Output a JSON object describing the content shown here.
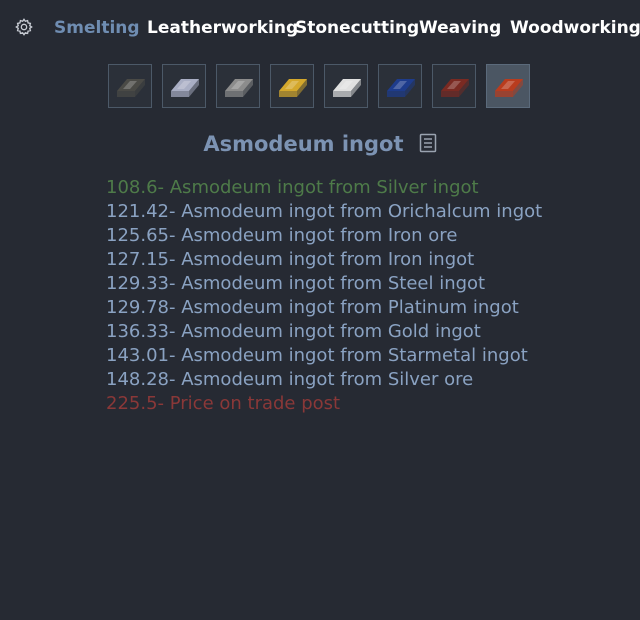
{
  "nav": {
    "settings_icon": "gear-icon",
    "tabs": [
      {
        "label": "Smelting",
        "active": true
      },
      {
        "label": "Leatherworking",
        "active": false
      },
      {
        "label": "Stonecutting",
        "active": false
      },
      {
        "label": "Weaving",
        "active": false
      },
      {
        "label": "Woodworking",
        "active": false
      }
    ]
  },
  "materials": [
    {
      "icon": "iron-ingot-icon",
      "color": "#4a4a46",
      "selected": false
    },
    {
      "icon": "steel-ingot-icon",
      "color": "#a9aec4",
      "selected": false
    },
    {
      "icon": "starmetal-ingot-icon",
      "color": "#8c8c8c",
      "selected": false
    },
    {
      "icon": "gold-ingot-icon",
      "color": "#d4a82c",
      "selected": false
    },
    {
      "icon": "silver-ingot-icon",
      "color": "#e0e0e0",
      "selected": false
    },
    {
      "icon": "orichalcum-ingot-icon",
      "color": "#1e3c8c",
      "selected": false
    },
    {
      "icon": "platinum-ingot-icon",
      "color": "#7a2a22",
      "selected": false
    },
    {
      "icon": "asmodeum-ingot-icon",
      "color": "#b93c1e",
      "selected": true
    }
  ],
  "item": {
    "title": "Asmodeum ingot",
    "details_icon": "document-icon"
  },
  "recipes": [
    {
      "text": "108.6- Asmodeum ingot from Silver ingot",
      "kind": "best"
    },
    {
      "text": "121.42- Asmodeum ingot from Orichalcum ingot",
      "kind": "normal"
    },
    {
      "text": "125.65- Asmodeum ingot from Iron ore",
      "kind": "normal"
    },
    {
      "text": "127.15- Asmodeum ingot from Iron ingot",
      "kind": "normal"
    },
    {
      "text": "129.33- Asmodeum ingot from Steel ingot",
      "kind": "normal"
    },
    {
      "text": "129.78- Asmodeum ingot from Platinum ingot",
      "kind": "normal"
    },
    {
      "text": "136.33- Asmodeum ingot from Gold ingot",
      "kind": "normal"
    },
    {
      "text": "143.01- Asmodeum ingot from Starmetal ingot",
      "kind": "normal"
    },
    {
      "text": "148.28- Asmodeum ingot from Silver ore",
      "kind": "normal"
    },
    {
      "text": "225.5- Price on trade post",
      "kind": "market"
    }
  ],
  "colors": {
    "background": "#262a33",
    "accent": "#6f8db2",
    "best": "#4e7b49",
    "normal": "#8aa2c2",
    "market": "#8a3838"
  }
}
